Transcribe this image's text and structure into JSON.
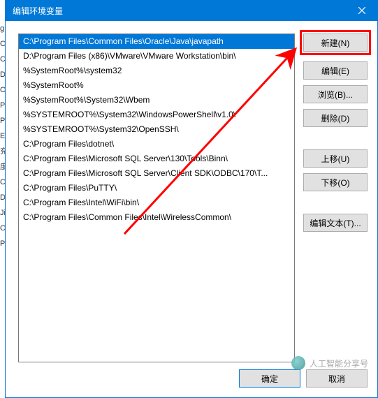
{
  "titlebar": {
    "title": "编辑环境变量"
  },
  "list": {
    "items": [
      "C:\\Program Files\\Common Files\\Oracle\\Java\\javapath",
      "D:\\Program Files (x86)\\VMware\\VMware Workstation\\bin\\",
      "%SystemRoot%\\system32",
      "%SystemRoot%",
      "%SystemRoot%\\System32\\Wbem",
      "%SYSTEMROOT%\\System32\\WindowsPowerShell\\v1.0\\",
      "%SYSTEMROOT%\\System32\\OpenSSH\\",
      "C:\\Program Files\\dotnet\\",
      "C:\\Program Files\\Microsoft SQL Server\\130\\Tools\\Binn\\",
      "C:\\Program Files\\Microsoft SQL Server\\Client SDK\\ODBC\\170\\T...",
      "C:\\Program Files\\PuTTY\\",
      "C:\\Program Files\\Intel\\WiFi\\bin\\",
      "C:\\Program Files\\Common Files\\Intel\\WirelessCommon\\"
    ],
    "selected_index": 0
  },
  "buttons": {
    "new": "新建(N)",
    "edit": "编辑(E)",
    "browse": "浏览(B)...",
    "delete": "删除(D)",
    "move_up": "上移(U)",
    "move_down": "下移(O)",
    "edit_text": "编辑文本(T)...",
    "ok": "确定",
    "cancel": "取消"
  },
  "watermark": {
    "text": "人工智能分享号"
  },
  "bg_fragments": [
    "g",
    "CI",
    "Ci",
    "D",
    "O",
    "Pi",
    "Pi",
    "E",
    "",
    "充",
    "度",
    "",
    "Ci",
    "D",
    "Ji",
    "O",
    "Pi"
  ]
}
